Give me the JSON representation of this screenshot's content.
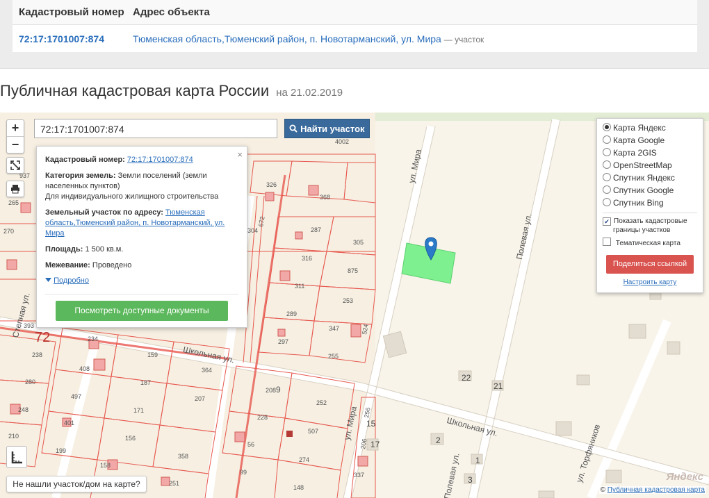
{
  "table": {
    "col_number": "Кадастровый номер",
    "col_address": "Адрес объекта",
    "row_number": "72:17:1701007:874",
    "row_address": "Тюменская область,Тюменский район, п. Новотарманский, ул. Мира",
    "row_suffix": "— участок"
  },
  "title": "Публичная кадастровая карта России",
  "title_date": "на 21.02.2019",
  "search": {
    "value": "72:17:1701007:874",
    "button_label": "Найти участок"
  },
  "zoom": {
    "plus": "+",
    "minus": "−"
  },
  "popup": {
    "cad_label": "Кадастровый номер:",
    "cad_value": "72:17:1701007:874",
    "cat_label": "Категория земель:",
    "cat_value": "Земли поселений (земли населенных пунктов)",
    "cat_use": "Для индивидуального жилищного строительства",
    "addr_label": "Земельный участок по адресу:",
    "addr_value": "Тюменская область,Тюменский район, п. Новотарманский, ул. Мира",
    "area_label": "Площадь:",
    "area_value": "1 500 кв.м.",
    "survey_label": "Межевание:",
    "survey_value": "Проведено",
    "more": "Подробно",
    "docs_button": "Посмотреть доступные документы",
    "close": "×"
  },
  "layers": {
    "options": [
      "Карта Яндекс",
      "Карта Google",
      "Карта 2GIS",
      "OpenStreetMap",
      "Спутник Яндекс",
      "Спутник Google",
      "Спутник Bing"
    ],
    "selected": "Карта Яндекс",
    "show_borders": "Показать кадастровые границы участков",
    "thematic": "Тематическая карта",
    "share": "Поделиться ссылкой",
    "adjust": "Настроить карту"
  },
  "not_found": "Не нашли участок/дом на карте?",
  "copyright_prefix": "©",
  "copyright_link": "Публичная кадастровая карта",
  "yandex_logo": "Яндекс",
  "streets": {
    "mira1": "ул. Мира",
    "mira2": "ул. Мира",
    "polevaya1": "Полевая ул.",
    "polevaya2": "Полевая ул.",
    "shkolnaya1": "Школьная ул.",
    "shkolnaya2": "Школьная ул.",
    "stepnaya": "Степная ул.",
    "torfyanikov": "ул. Торфяников"
  },
  "plots": [
    "326",
    "368",
    "672",
    "304",
    "287",
    "305",
    "316",
    "875",
    "311",
    "253",
    "289",
    "347",
    "297",
    "255",
    "234",
    "408",
    "159",
    "364",
    "187",
    "207",
    "497",
    "280",
    "238",
    "393",
    "270",
    "265",
    "937",
    "171",
    "401",
    "248",
    "210",
    "156",
    "199",
    "358",
    "251",
    "158",
    "208",
    "9",
    "228",
    "252",
    "56",
    "507",
    "274",
    "99",
    "148",
    "337",
    "256",
    "206",
    "4002",
    "524",
    "22",
    "21",
    "2",
    "1",
    "3",
    "17",
    "15",
    "72"
  ],
  "colors": {
    "parcel_line": "#e8584f",
    "highlight": "#7ff08f",
    "marker": "#2a7ac7"
  }
}
